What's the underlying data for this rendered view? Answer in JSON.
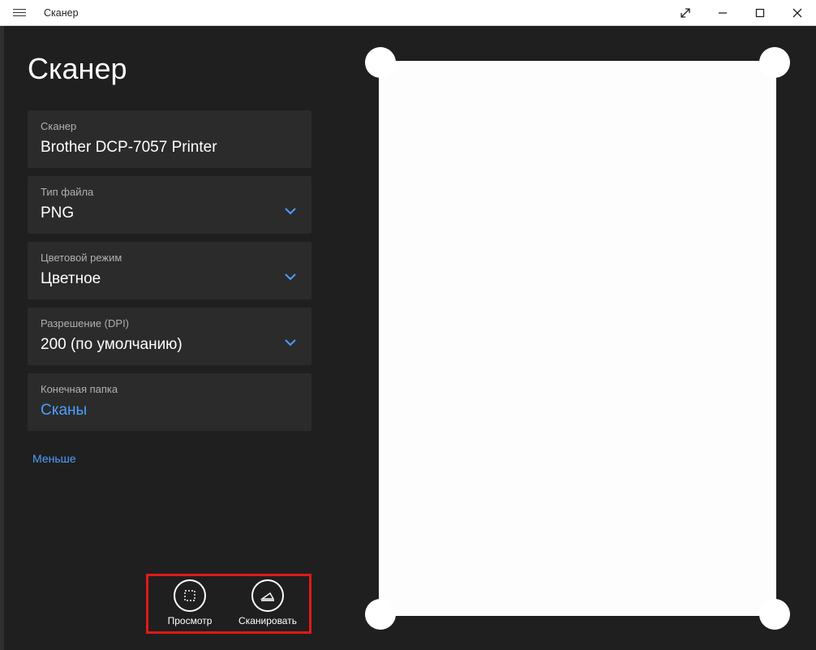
{
  "titlebar": {
    "app_name": "Сканер"
  },
  "page": {
    "title": "Сканер"
  },
  "fields": {
    "scanner": {
      "label": "Сканер",
      "value": "Brother DCP-7057 Printer"
    },
    "filetype": {
      "label": "Тип файла",
      "value": "PNG"
    },
    "colormode": {
      "label": "Цветовой режим",
      "value": "Цветное"
    },
    "dpi": {
      "label": "Разрешение (DPI)",
      "value": "200 (по умолчанию)"
    },
    "destfolder": {
      "label": "Конечная папка",
      "value": "Сканы"
    }
  },
  "links": {
    "less": "Меньше"
  },
  "actions": {
    "preview": "Просмотр",
    "scan": "Сканировать"
  },
  "colors": {
    "accent": "#4c9fff",
    "highlight_box": "#e11919"
  }
}
